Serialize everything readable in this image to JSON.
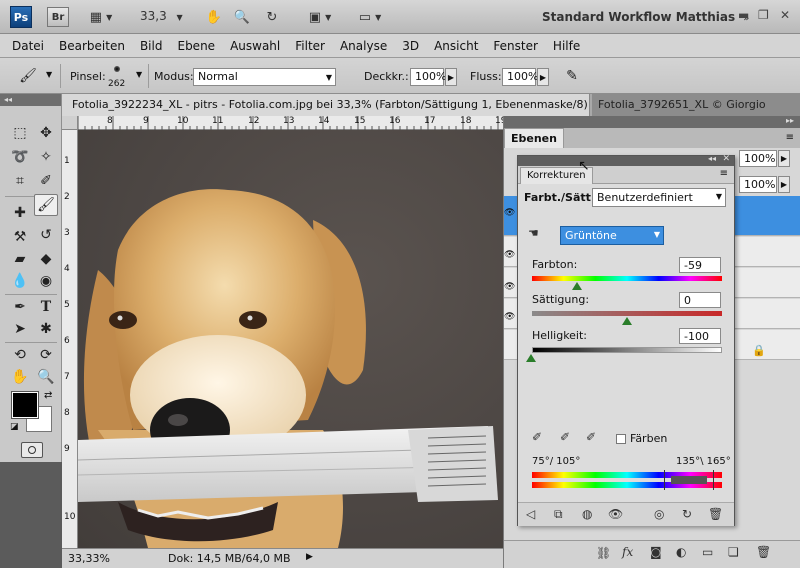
{
  "appbar": {
    "ps_logo": "Ps",
    "br_logo": "Br",
    "zoom": "33,3",
    "workspace": "Standard Workflow Matthias"
  },
  "menu": [
    "Datei",
    "Bearbeiten",
    "Bild",
    "Ebene",
    "Auswahl",
    "Filter",
    "Analyse",
    "3D",
    "Ansicht",
    "Fenster",
    "Hilfe"
  ],
  "options": {
    "brush_label": "Pinsel:",
    "brush_size": "262",
    "mode_label": "Modus:",
    "mode_value": "Normal",
    "opacity_label": "Deckkr.:",
    "opacity_value": "100%",
    "flow_label": "Fluss:",
    "flow_value": "100%"
  },
  "tabs": {
    "active": "Fotolia_3922234_XL - pitrs - Fotolia.com.jpg bei 33,3% (Farbton/Sättigung 1, Ebenenmaske/8) *",
    "inactive": "Fotolia_3792651_XL © Giorgio"
  },
  "ruler_top": [
    "8",
    "9",
    "10",
    "11",
    "12",
    "13",
    "14",
    "15",
    "16",
    "17",
    "18",
    "19"
  ],
  "ruler_left": [
    "1",
    "2",
    "3",
    "4",
    "5",
    "6",
    "7",
    "8",
    "9",
    "10"
  ],
  "status": {
    "zoom": "33,33%",
    "doc": "Dok: 14,5 MB/64,0 MB"
  },
  "layers": {
    "title": "Ebenen",
    "opacity": "100%",
    "fill": "100%"
  },
  "adjustments": {
    "title": "Korrekturen",
    "type_label": "Farbt./Sätt.",
    "preset": "Benutzerdefiniert",
    "channel": "Grüntöne",
    "hue_label": "Farbton:",
    "hue_value": "-59",
    "saturation_label": "Sättigung:",
    "saturation_value": "0",
    "lightness_label": "Helligkeit:",
    "lightness_value": "-100",
    "colorize_label": "Färben",
    "range_left": "75°/ 105°",
    "range_right": "135°\\ 165°",
    "accent": "#3d8fe0"
  }
}
